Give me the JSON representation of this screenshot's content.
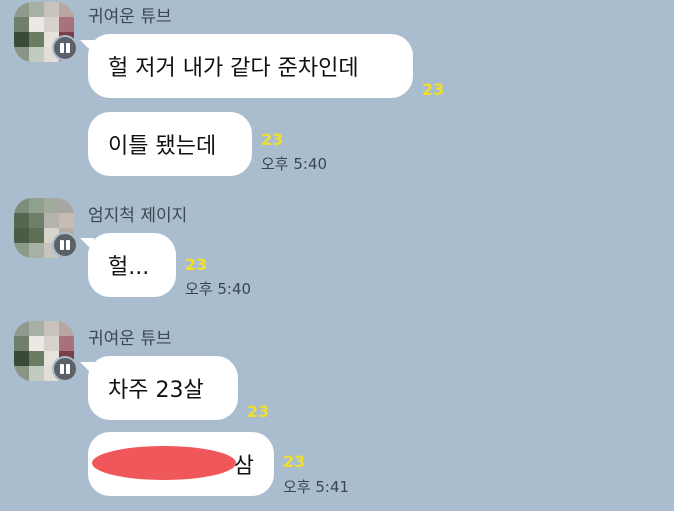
{
  "messages": [
    {
      "sender": "귀여운 튜브",
      "bubbles": [
        {
          "text": "헐 저거 내가 같다 준차인데",
          "unread": "23",
          "time": ""
        },
        {
          "text": "이틀 됐는데",
          "unread": "23",
          "time": "오후 5:40"
        }
      ]
    },
    {
      "sender": "엄지척 제이지",
      "bubbles": [
        {
          "text": "헐...",
          "unread": "23",
          "time": "오후 5:40"
        }
      ]
    },
    {
      "sender": "귀여운 튜브",
      "bubbles": [
        {
          "text": "차주 23살",
          "unread": "23",
          "time": ""
        },
        {
          "text": "삼",
          "unread": "23",
          "time": "오후 5:41"
        }
      ]
    }
  ],
  "colors": {
    "background": "#a9bdcf",
    "bubble": "#ffffff",
    "unread": "#f0df2a",
    "redaction": "#f0575a"
  }
}
